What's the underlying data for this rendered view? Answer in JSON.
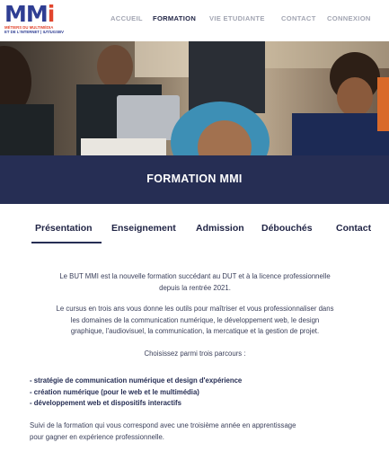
{
  "logo": {
    "mark_main": "MM",
    "mark_accent": "i",
    "line1": "MÉTIERS DU MULTIMÉDIA",
    "line2": "ET DE L'INTERNET | IUT/UGSBV"
  },
  "nav": {
    "items": [
      {
        "label": "ACCUEIL"
      },
      {
        "label": "FORMATION"
      },
      {
        "label": "VIE ETUDIANTE"
      },
      {
        "label": "CONTACT"
      },
      {
        "label": "CONNEXION"
      }
    ]
  },
  "banner": {
    "title": "FORMATION MMI"
  },
  "tabs": [
    {
      "label": "Présentation"
    },
    {
      "label": "Enseignement"
    },
    {
      "label": "Admission"
    },
    {
      "label": "Débouchés"
    },
    {
      "label": "Contact"
    }
  ],
  "content": {
    "intro_line1": "Le BUT MMI est la nouvelle formation succédant au DUT et à la licence professionnelle",
    "intro_line2": "depuis la rentrée 2021.",
    "cursus_line1": "Le cursus en trois ans vous donne les outils pour maîtriser et vous professionnaliser dans",
    "cursus_line2": "les domaines de la communication numérique, le développement web, le design",
    "cursus_line3": "graphique, l'audiovisuel, la communication, la mercatique et la gestion de projet.",
    "choose": "Choisissez parmi trois parcours :",
    "parcours": [
      "- stratégie de communication numérique et design d'expérience",
      "- création numérique (pour le web et le multimédia)",
      "- développement web et dispositifs interactifs"
    ],
    "outro_line1": "Suivi de la formation qui vous correspond avec une troisième année en apprentissage",
    "outro_line2": "pour gagner en expérience professionnelle."
  }
}
